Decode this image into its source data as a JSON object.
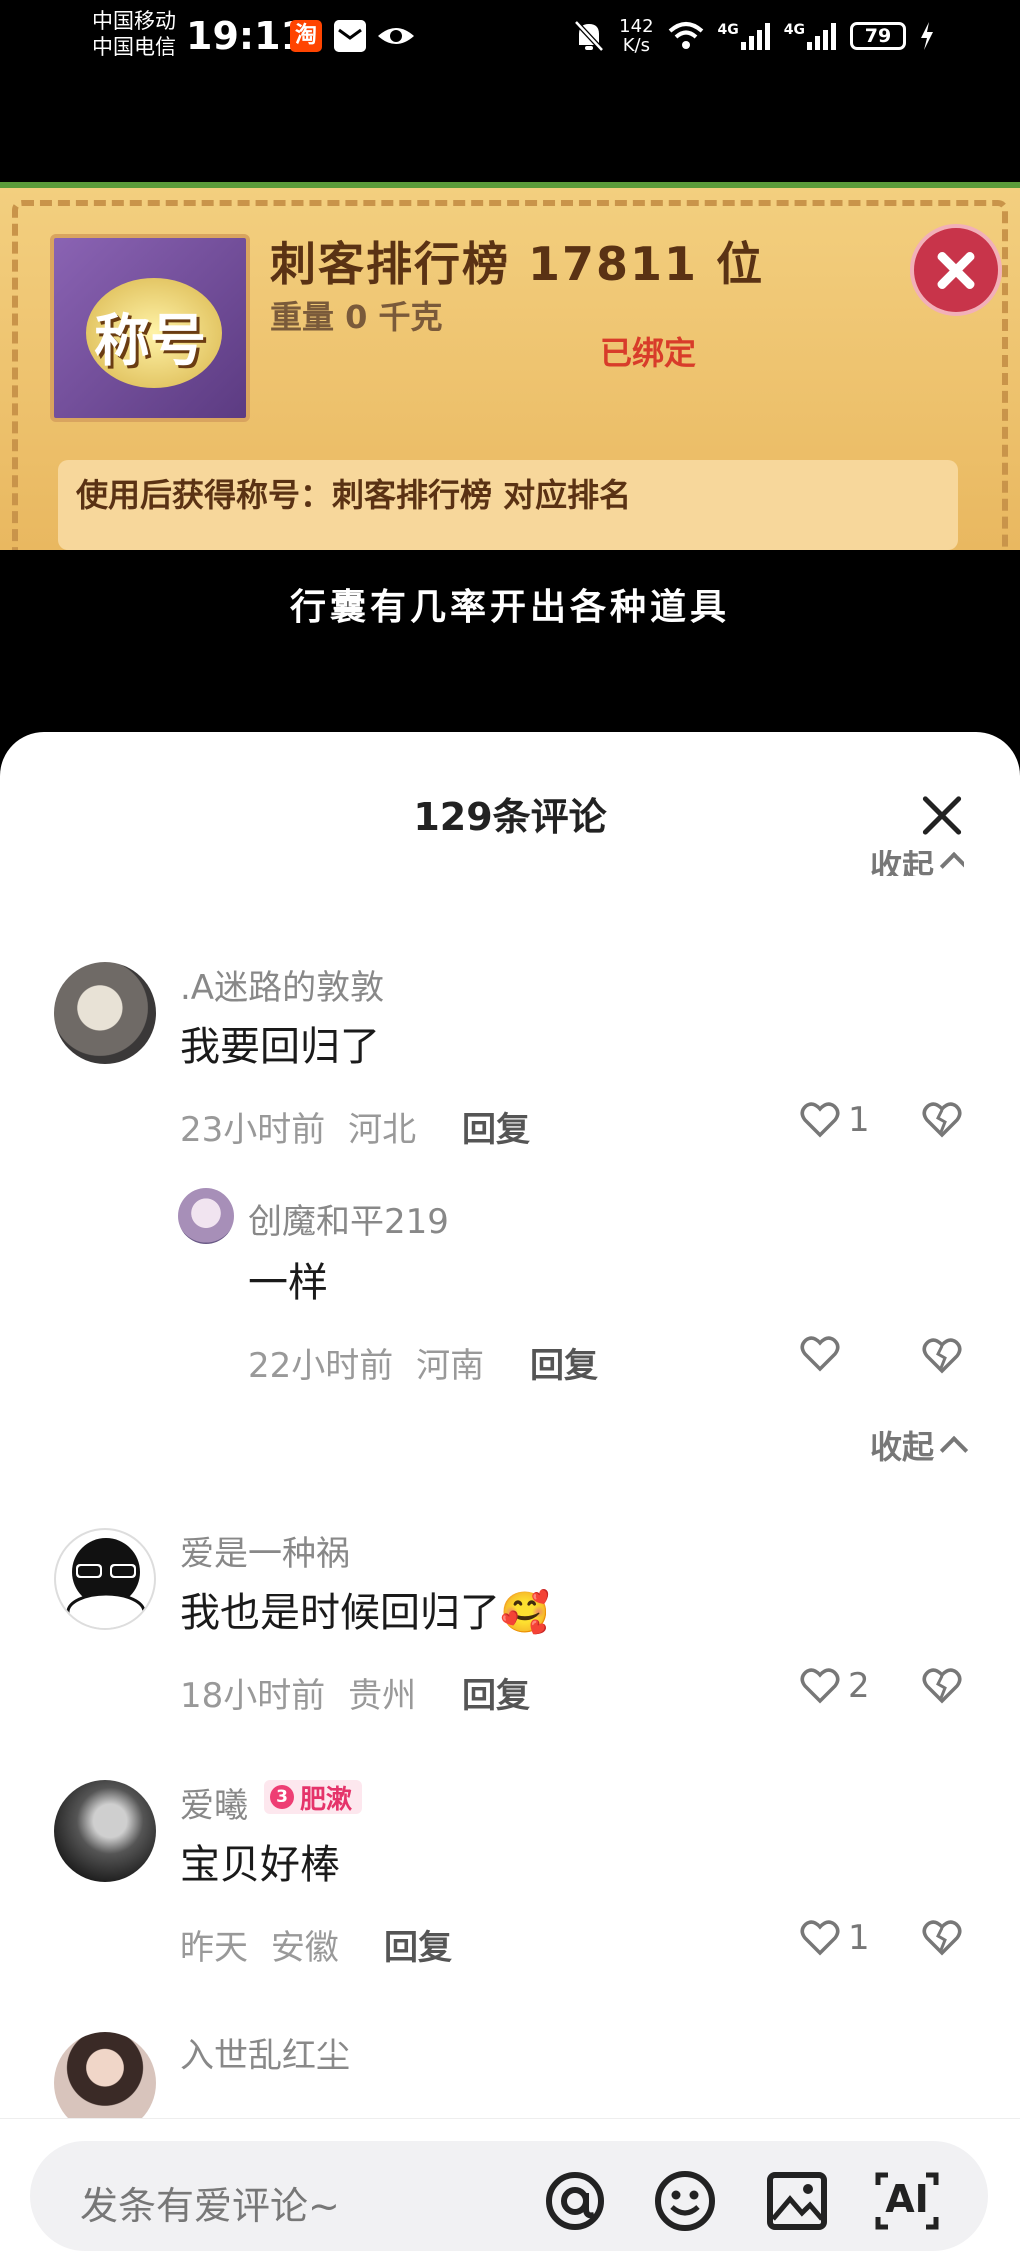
{
  "status_bar": {
    "carrier1": "中国移动",
    "carrier2": "中国电信",
    "time": "19:11",
    "taobao_glyph": "淘",
    "net_speed_value": "142",
    "net_speed_unit": "K/s",
    "network1": "4G",
    "network2": "4G",
    "battery": "79"
  },
  "video": {
    "icon_label": "称号",
    "item_name": "刺客排行榜 17811 位",
    "weight": "重量  0 千克",
    "bound": "已绑定",
    "description": "使用后获得称号：刺客排行榜 对应排名",
    "subtitle": "行囊有几率开出各种道具"
  },
  "panel": {
    "title": "129条评论",
    "collapse_label": "收起"
  },
  "comments": [
    {
      "name": ".A迷路的敦敦",
      "text": "我要回归了",
      "time": "23小时前",
      "location": "河北",
      "reply_label": "回复",
      "likes": "1"
    },
    {
      "name": "创魔和平219",
      "text": "一样",
      "time": "22小时前",
      "location": "河南",
      "reply_label": "回复",
      "likes": ""
    },
    {
      "name": "爱是一种祸",
      "text": "我也是时候回归了",
      "emoji": "🥰",
      "time": "18小时前",
      "location": "贵州",
      "reply_label": "回复",
      "likes": "2"
    },
    {
      "name": "爱曦",
      "badge_level": "3",
      "badge_text": "肥漱",
      "text": "宝贝好棒",
      "time": "昨天",
      "location": "安徽",
      "reply_label": "回复",
      "likes": "1"
    },
    {
      "name": "入世乱红尘"
    }
  ],
  "input": {
    "placeholder": "发条有爱评论~",
    "ai_label": "AI"
  }
}
